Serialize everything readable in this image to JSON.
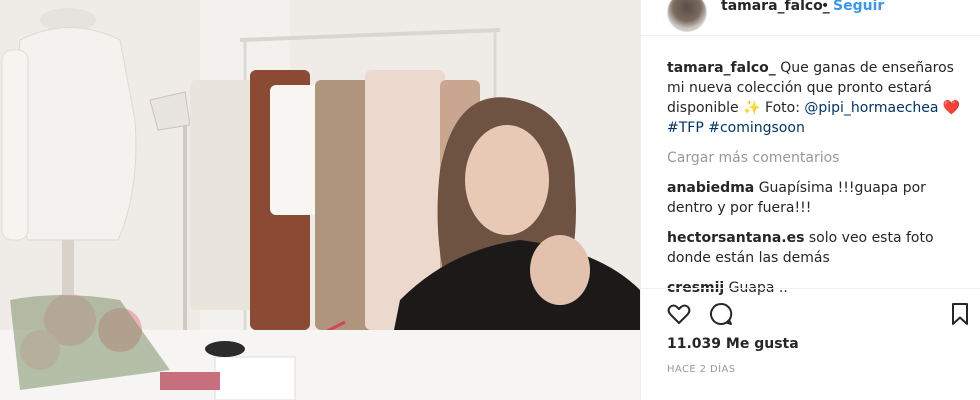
{
  "header": {
    "username": "tamara_falco_",
    "separator": "•",
    "follow_label": "Seguir"
  },
  "caption": {
    "username": "tamara_falco_",
    "text_part1": "Que ganas de enseñaros mi nueva colección que pronto estará disponible ",
    "sparkle": "✨",
    "foto_label": "Foto: ",
    "photo_credit": "@pipi_hormaechea",
    "heart": "❤️",
    "hashtag_1": "#TFP",
    "hashtag_2": "#comingsoon"
  },
  "load_more_label": "Cargar más comentarios",
  "comments": [
    {
      "username": "anabiedma",
      "text": "Guapísima !!!guapa por dentro y por fuera!!!"
    },
    {
      "username": "hectorsantana.es",
      "text": "solo veo esta foto donde están las demás"
    },
    {
      "username": "cresmij",
      "text": "Guapa .."
    }
  ],
  "actions": {
    "like_icon": "heart-outline-icon",
    "comment_icon": "speech-bubble-icon",
    "save_icon": "bookmark-icon"
  },
  "likes_label": "11.039 Me gusta",
  "timestamp": "HACE 2 DÍAS",
  "colors": {
    "link": "#003569",
    "follow": "#3897f0",
    "muted": "#999999",
    "text": "#262626"
  }
}
